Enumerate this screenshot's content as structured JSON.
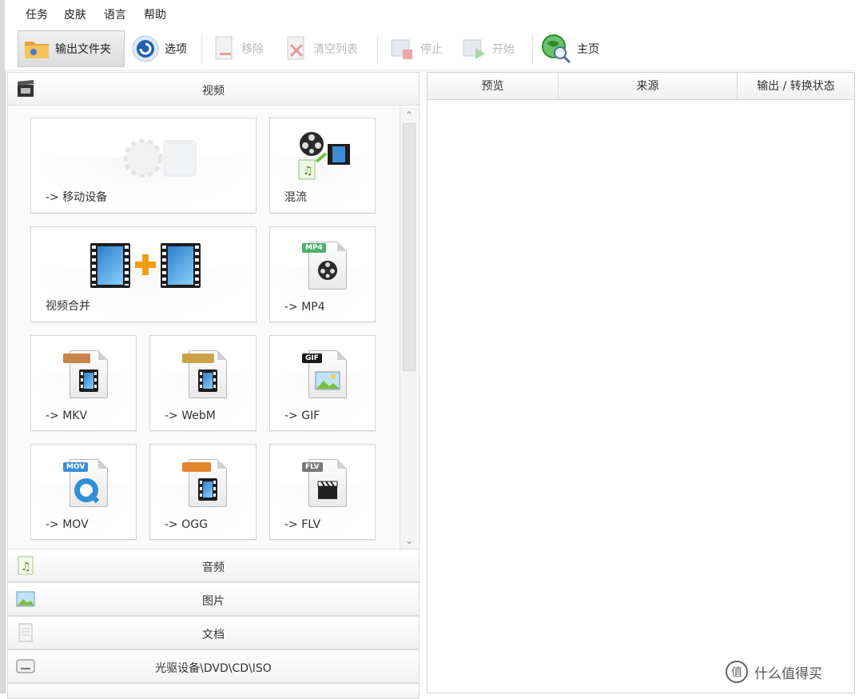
{
  "menu": [
    "任务",
    "皮肤",
    "语言",
    "帮助"
  ],
  "toolbar": {
    "output_folder": "输出文件夹",
    "options": "选项",
    "remove": "移除",
    "clear_list": "清空列表",
    "stop": "停止",
    "start": "开始",
    "home": "主页"
  },
  "categories": {
    "video": "视频",
    "audio": "音频",
    "image": "图片",
    "document": "文档",
    "optical": "光驱设备\\DVD\\CD\\ISO"
  },
  "tiles": {
    "mobile": "-> 移动设备",
    "mux": "混流",
    "merge": "视频合并",
    "mp4": "-> MP4",
    "mkv": "-> MKV",
    "webm": "-> WebM",
    "gif": "-> GIF",
    "mov": "-> MOV",
    "ogg": "-> OGG",
    "flv": "-> FLV"
  },
  "tags": {
    "mp4": "MP4",
    "gif": "GIF",
    "mov": "MOV",
    "flv": "FLV"
  },
  "columns": {
    "preview": "预览",
    "source": "来源",
    "status": "输出 / 转换状态"
  },
  "watermark": {
    "icon": "值",
    "text": "什么值得买"
  },
  "colors": {
    "accent_orange": "#f39c12",
    "film_blue": "#2c7ec9",
    "globe_green": "#3aa33a"
  }
}
